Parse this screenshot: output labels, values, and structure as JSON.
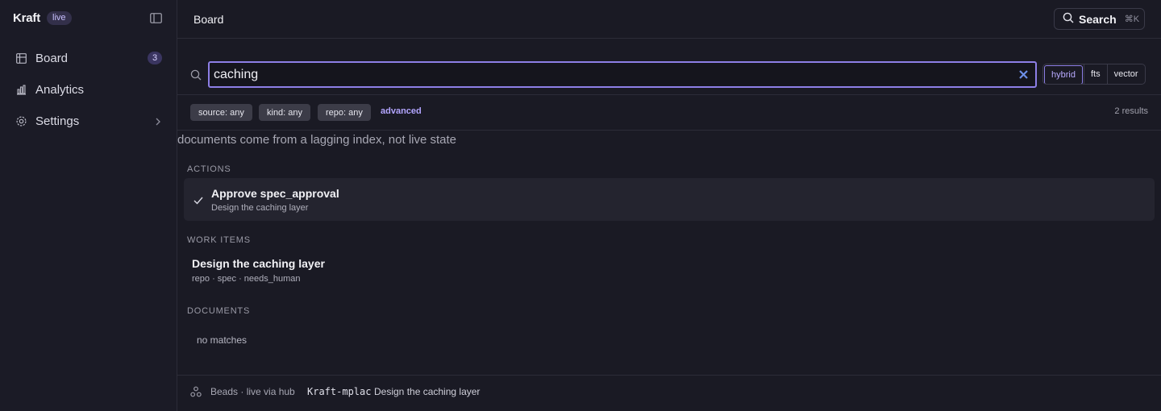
{
  "app": {
    "name": "Kraft",
    "status_badge": "live"
  },
  "sidebar": {
    "items": [
      {
        "label": "Board",
        "icon": "board-icon",
        "badge": "3"
      },
      {
        "label": "Analytics",
        "icon": "analytics-icon"
      },
      {
        "label": "Settings",
        "icon": "gear-icon",
        "chevron": true
      }
    ]
  },
  "header": {
    "title": "Board",
    "search_button": {
      "label": "Search",
      "shortcut": "⌘K"
    }
  },
  "search": {
    "query": "caching",
    "modes": [
      "hybrid",
      "fts",
      "vector"
    ],
    "active_mode": "hybrid"
  },
  "filters": {
    "chips": [
      "source: any",
      "kind: any",
      "repo: any"
    ],
    "advanced_label": "advanced",
    "results_count": "2 results"
  },
  "notice": "documents come from a lagging index, not live state",
  "sections": {
    "actions": {
      "label": "ACTIONS",
      "items": [
        {
          "title": "Approve spec_approval",
          "subtitle": "Design the caching layer"
        }
      ]
    },
    "work_items": {
      "label": "WORK ITEMS",
      "items": [
        {
          "title": "Design the caching layer",
          "meta": "repo · spec · needs_human"
        }
      ]
    },
    "documents": {
      "label": "DOCUMENTS",
      "empty_text": "no matches"
    }
  },
  "footer": {
    "source": "Beads · live via hub",
    "id": "Kraft-mplac",
    "title": "Design the caching layer"
  },
  "colors": {
    "accent": "#8d7fe6",
    "background": "#1a1a24",
    "chip_bg": "#3c3c48"
  }
}
